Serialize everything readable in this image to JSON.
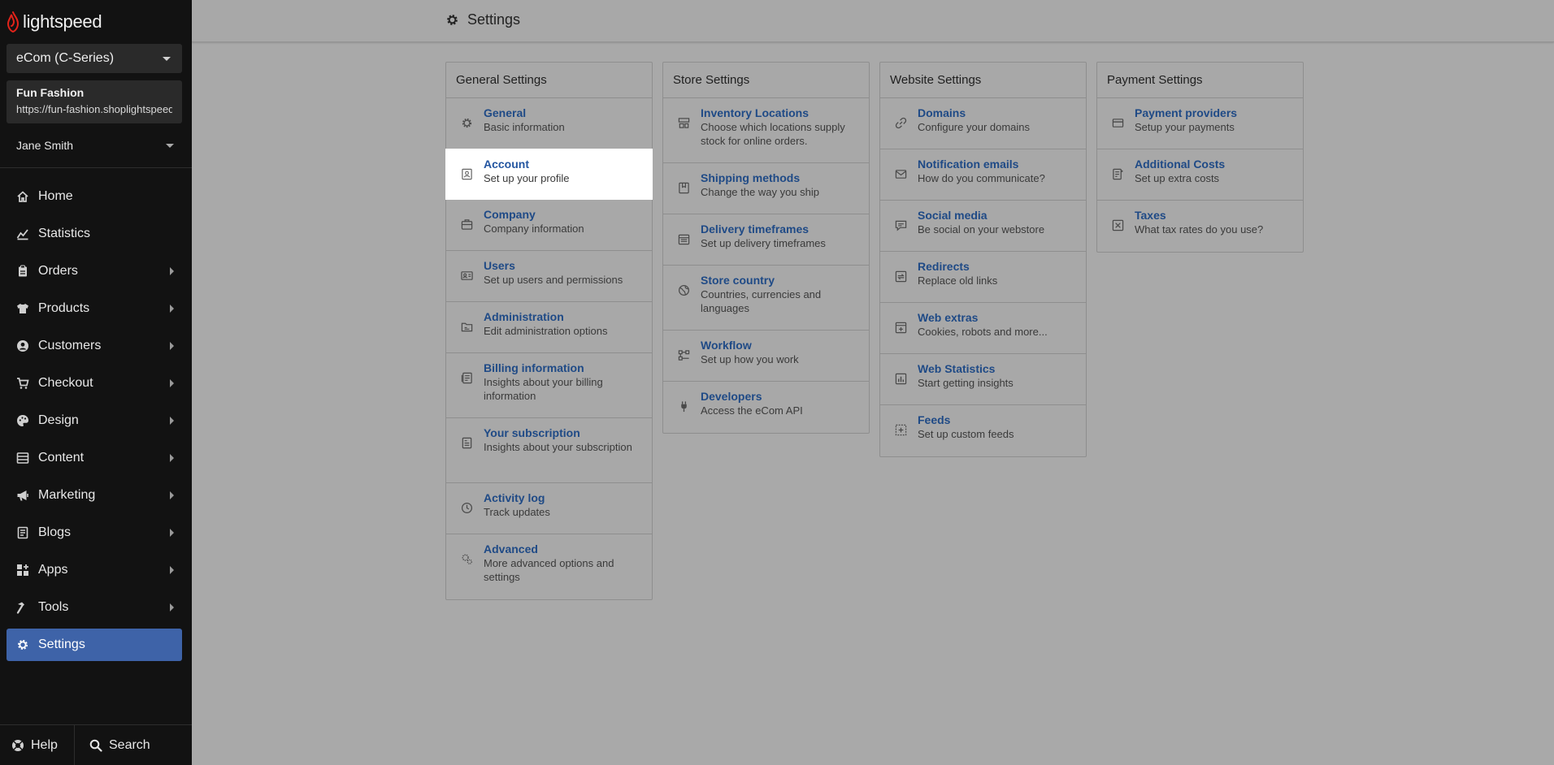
{
  "brand": {
    "name": "lightspeed",
    "accent": "#e2231a"
  },
  "sidebar": {
    "env_label": "eCom (C-Series)",
    "store_name": "Fun Fashion",
    "store_url": "https://fun-fashion.shoplightspeed.com",
    "user_name": "Jane Smith",
    "items": [
      {
        "label": "Home",
        "icon": "home-icon"
      },
      {
        "label": "Statistics",
        "icon": "chart-icon"
      },
      {
        "label": "Orders",
        "icon": "clipboard-icon"
      },
      {
        "label": "Products",
        "icon": "shirt-icon"
      },
      {
        "label": "Customers",
        "icon": "user-circle-icon"
      },
      {
        "label": "Checkout",
        "icon": "cart-icon"
      },
      {
        "label": "Design",
        "icon": "palette-icon"
      },
      {
        "label": "Content",
        "icon": "layout-icon"
      },
      {
        "label": "Marketing",
        "icon": "megaphone-icon"
      },
      {
        "label": "Blogs",
        "icon": "book-icon"
      },
      {
        "label": "Apps",
        "icon": "grid-icon"
      },
      {
        "label": "Tools",
        "icon": "hammer-icon"
      },
      {
        "label": "Settings",
        "icon": "gear-icon"
      }
    ],
    "help_label": "Help",
    "search_label": "Search",
    "active_color": "#3e63a8"
  },
  "header": {
    "title": "Settings"
  },
  "columns": [
    {
      "title": "General Settings",
      "rows": [
        {
          "title": "General",
          "desc": "Basic information",
          "icon": "gear-icon"
        },
        {
          "title": "Account",
          "desc": "Set up your profile",
          "icon": "account-icon"
        },
        {
          "title": "Company",
          "desc": "Company information",
          "icon": "briefcase-icon"
        },
        {
          "title": "Users",
          "desc": "Set up users and permissions",
          "icon": "id-card-icon"
        },
        {
          "title": "Administration",
          "desc": "Edit administration options",
          "icon": "folder-icon"
        },
        {
          "title": "Billing information",
          "desc": "Insights about your billing information",
          "icon": "billing-icon"
        },
        {
          "title": "Your subscription",
          "desc": "Insights about your subscription",
          "icon": "subscription-icon"
        },
        {
          "title": "Activity log",
          "desc": "Track updates",
          "icon": "clock-icon"
        },
        {
          "title": "Advanced",
          "desc": "More advanced options and settings",
          "icon": "gears-icon"
        }
      ]
    },
    {
      "title": "Store Settings",
      "rows": [
        {
          "title": "Inventory Locations",
          "desc": "Choose which locations supply stock for online orders.",
          "icon": "warehouse-icon"
        },
        {
          "title": "Shipping methods",
          "desc": "Change the way you ship",
          "icon": "box-icon"
        },
        {
          "title": "Delivery timeframes",
          "desc": "Set up delivery timeframes",
          "icon": "calendar-icon"
        },
        {
          "title": "Store country",
          "desc": "Countries, currencies and languages",
          "icon": "globe-icon"
        },
        {
          "title": "Workflow",
          "desc": "Set up how you work",
          "icon": "workflow-icon"
        },
        {
          "title": "Developers",
          "desc": "Access the eCom API",
          "icon": "plug-icon"
        }
      ]
    },
    {
      "title": "Website Settings",
      "rows": [
        {
          "title": "Domains",
          "desc": "Configure your domains",
          "icon": "link-icon"
        },
        {
          "title": "Notification emails",
          "desc": "How do you communicate?",
          "icon": "mail-icon"
        },
        {
          "title": "Social media",
          "desc": "Be social on your webstore",
          "icon": "chat-icon"
        },
        {
          "title": "Redirects",
          "desc": "Replace old links",
          "icon": "redirect-icon"
        },
        {
          "title": "Web extras",
          "desc": "Cookies, robots and more...",
          "icon": "extras-icon"
        },
        {
          "title": "Web Statistics",
          "desc": "Start getting insights",
          "icon": "bar-chart-icon"
        },
        {
          "title": "Feeds",
          "desc": "Set up custom feeds",
          "icon": "feeds-icon"
        }
      ]
    },
    {
      "title": "Payment Settings",
      "rows": [
        {
          "title": "Payment providers",
          "desc": "Setup your payments",
          "icon": "credit-card-icon"
        },
        {
          "title": "Additional Costs",
          "desc": "Set up extra costs",
          "icon": "receipt-icon"
        },
        {
          "title": "Taxes",
          "desc": "What tax rates do you use?",
          "icon": "tax-icon"
        }
      ]
    }
  ]
}
